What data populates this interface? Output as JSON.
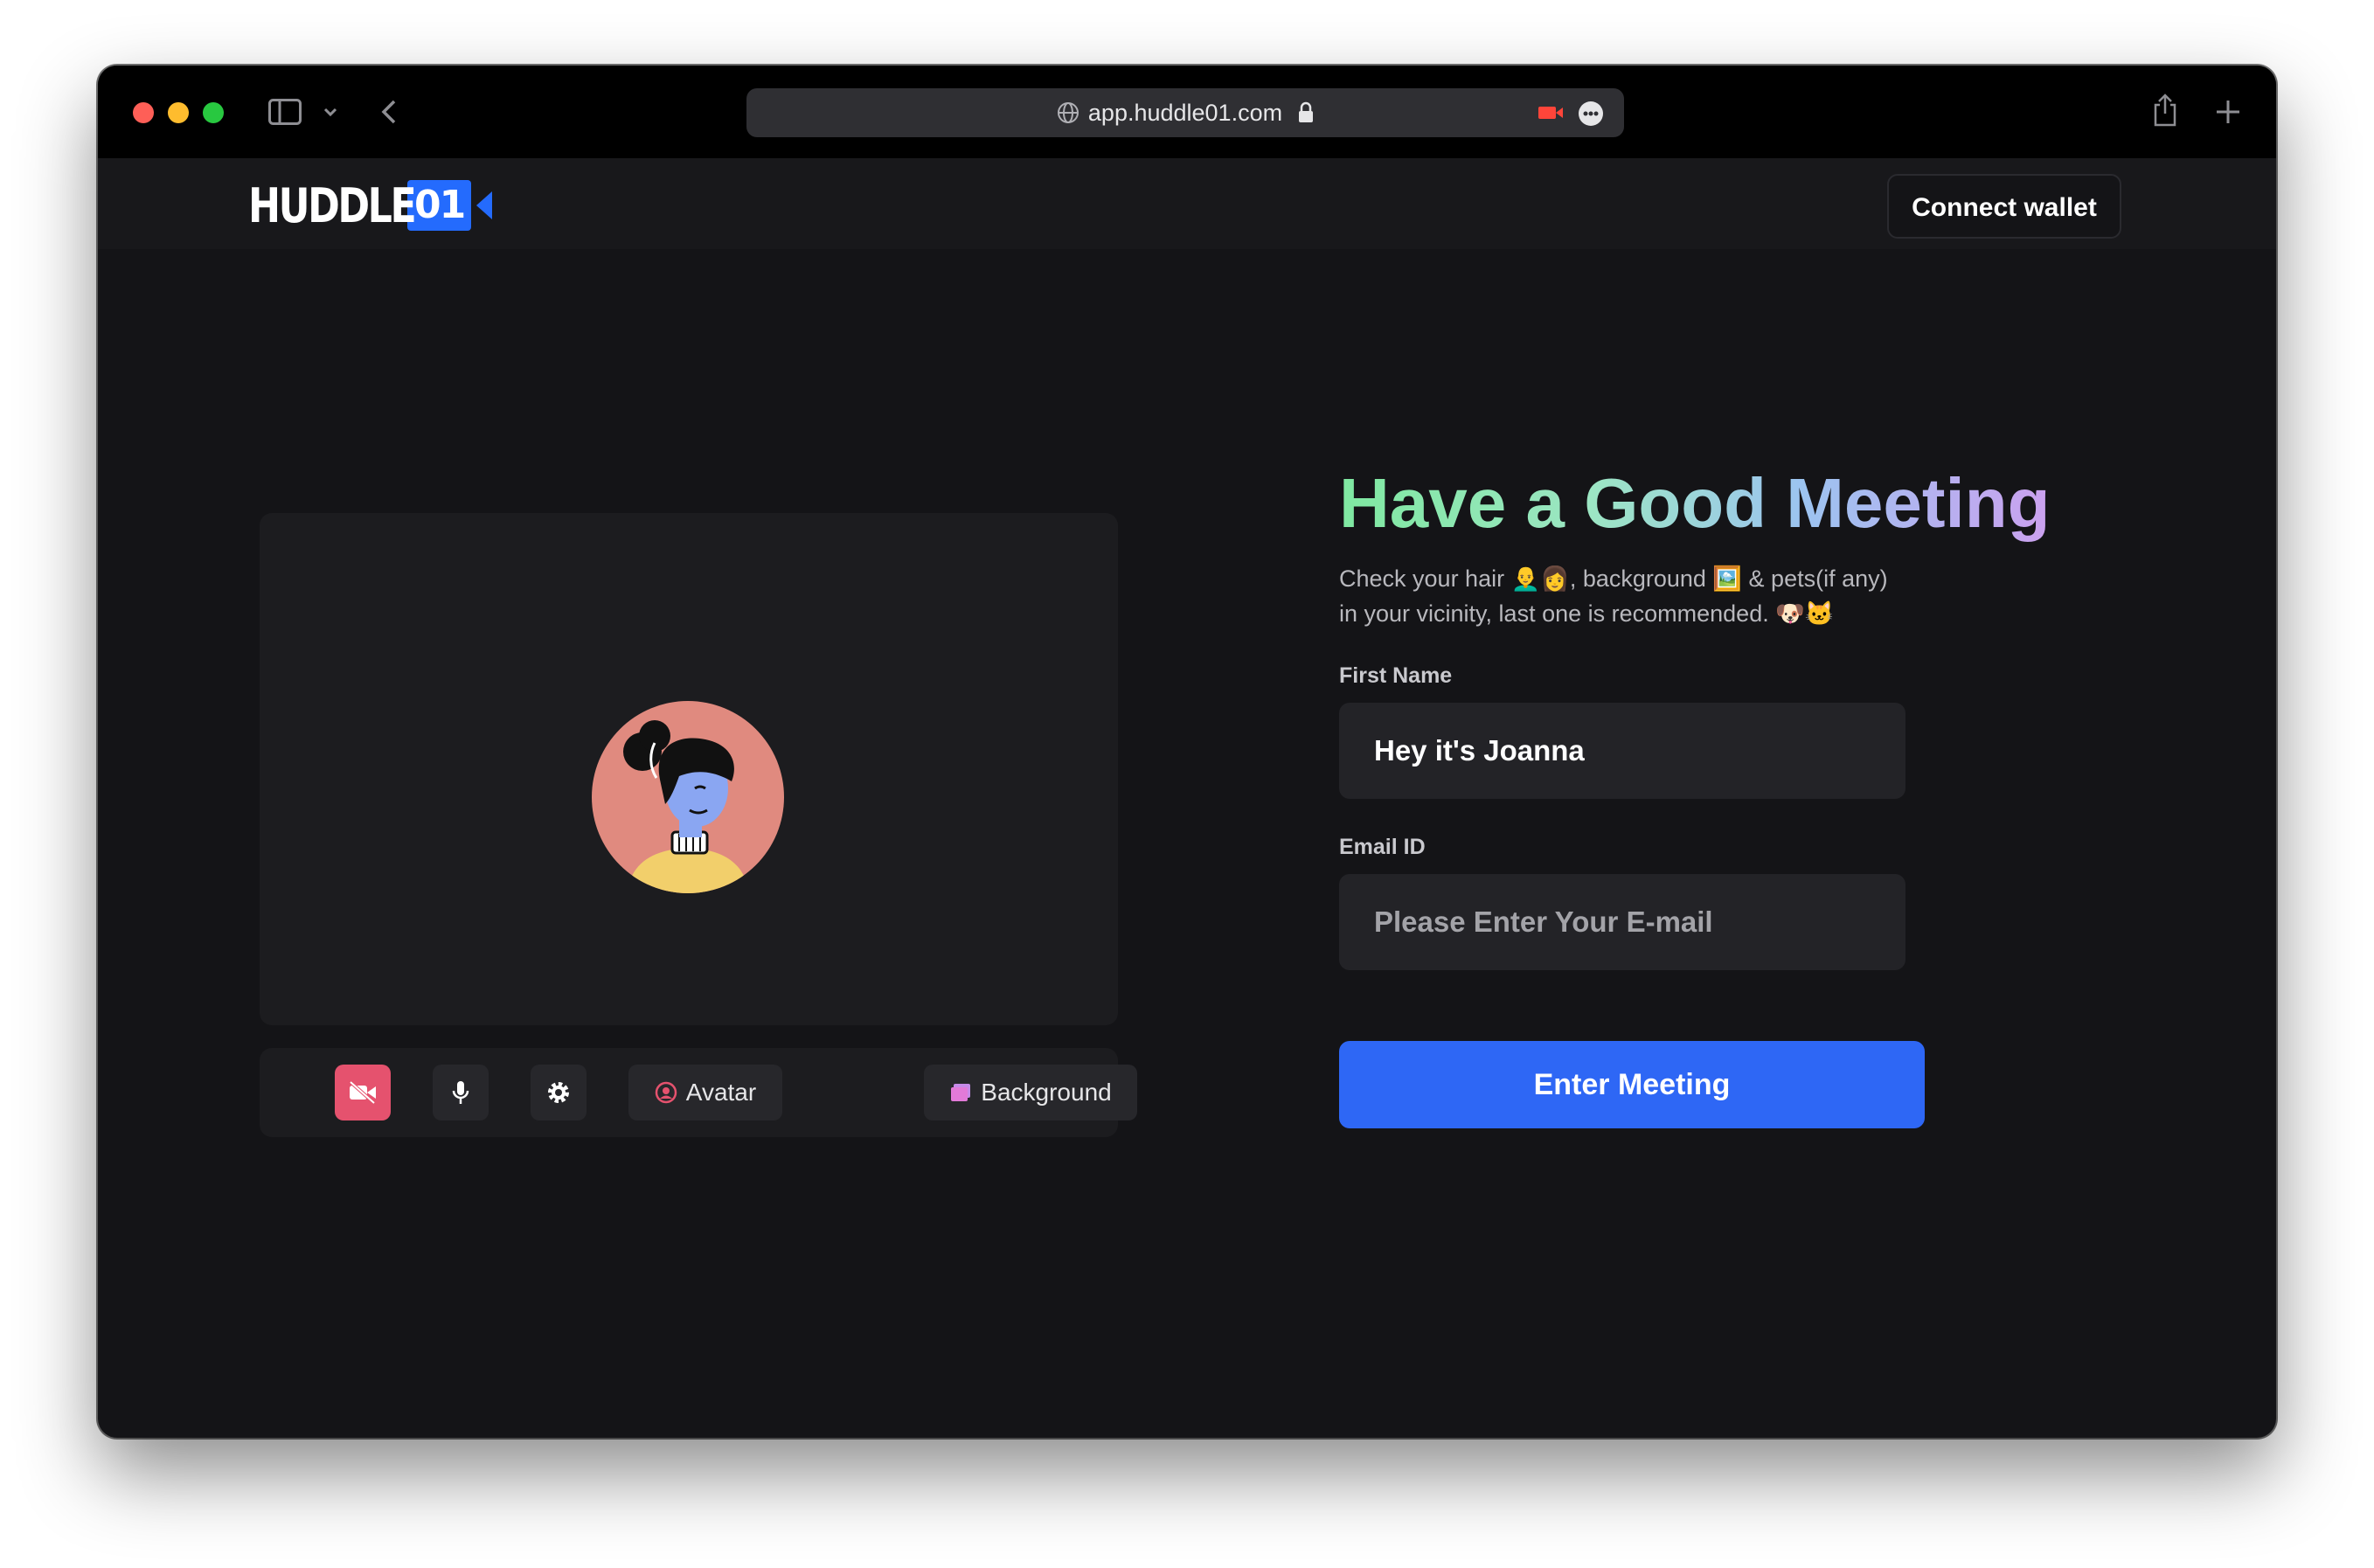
{
  "browser": {
    "url": "app.huddle01.com"
  },
  "brand": {
    "word": "HUDDLE",
    "number": "01",
    "accent": "#246bfd"
  },
  "header": {
    "connect_wallet": "Connect wallet"
  },
  "preview": {
    "controls": {
      "camera_icon": "video-off-icon",
      "mic_icon": "mic-icon",
      "settings_icon": "gear-icon",
      "avatar_label": "Avatar",
      "background_label": "Background"
    }
  },
  "form": {
    "heading": "Have a Good Meeting",
    "subtitle_line1": "Check your hair 👨‍🦲👩, background 🖼️ & pets(if any)",
    "subtitle_line2": "in your vicinity, last one is recommended. 🐶🐱",
    "first_name_label": "First Name",
    "first_name_value": "Hey it's Joanna",
    "email_label": "Email ID",
    "email_placeholder": "Please Enter Your E-mail",
    "submit_label": "Enter Meeting"
  },
  "colors": {
    "camera_off": "#e5526e",
    "primary_button": "#2e67f5",
    "page_bg": "#141417"
  }
}
